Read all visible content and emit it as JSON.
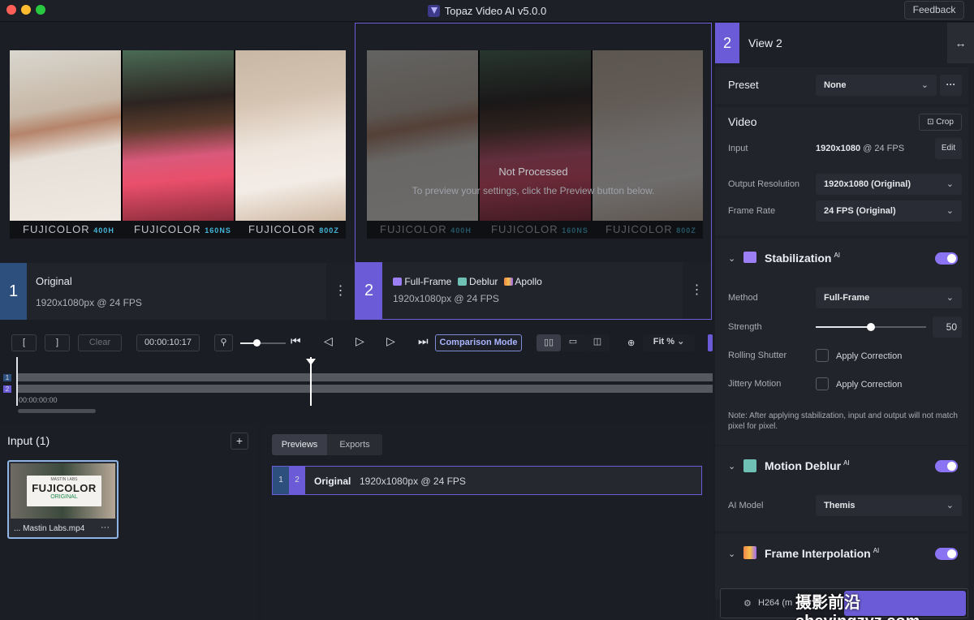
{
  "app": {
    "title": "Topaz Video AI  v5.0.0",
    "feedback": "Feedback"
  },
  "colors": {
    "accent": "#6b5bd6",
    "toggle": "#8b74f4",
    "bg": "#1b1d24"
  },
  "viewer": {
    "film_labels": [
      {
        "brand": "FUJICOLOR",
        "code": "400H"
      },
      {
        "brand": "FUJICOLOR",
        "code": "160NS"
      },
      {
        "brand": "FUJICOLOR",
        "code": "800Z"
      }
    ],
    "not_processed_title": "Not Processed",
    "not_processed_sub": "To preview your settings, click the Preview button below.",
    "view1": {
      "number": "1",
      "name": "Original",
      "meta": "1920x1080px @ 24 FPS",
      "more": "⋮"
    },
    "view2": {
      "number": "2",
      "models": [
        "Full-Frame",
        "Deblur",
        "Apollo"
      ],
      "meta": "1920x1080px @ 24 FPS",
      "more": "⋮"
    }
  },
  "transport": {
    "mark_in": "[",
    "mark_out": "]",
    "clear": "Clear",
    "timecode": "00:00:10:17",
    "comparison_mode": "Comparison Mode",
    "zoom": "Fit %",
    "zoom_slider_level": 0.35
  },
  "timeline": {
    "start_time": "00:00:00:00",
    "track1": "1",
    "track2": "2",
    "playhead_fraction": 0.42
  },
  "input_panel": {
    "title": "Input (1)",
    "add": "+",
    "thumb_text_top": "MASTIN LABS",
    "thumb_brand": "FUJICOLOR",
    "thumb_text_bottom": "ORIGINAL",
    "file_name": "... Mastin Labs.mp4",
    "file_more": "···"
  },
  "previews_panel": {
    "tabs": [
      "Previews",
      "Exports"
    ],
    "row": {
      "n1": "1",
      "n2": "2",
      "name": "Original",
      "meta": "1920x1080px @ 24 FPS"
    }
  },
  "sidebar": {
    "view_number": "2",
    "view_title": "View 2",
    "preset_label": "Preset",
    "preset_value": "None",
    "video_title": "Video",
    "crop": "Crop",
    "input_label": "Input",
    "input_res": "1920x1080",
    "input_fps": "@ 24 FPS",
    "edit": "Edit",
    "output_res_label": "Output Resolution",
    "output_res_value": "1920x1080 (Original)",
    "frame_rate_label": "Frame Rate",
    "frame_rate_value": "24 FPS (Original)",
    "stabilization": {
      "title": "Stabilization",
      "ai": "AI",
      "method_label": "Method",
      "method_value": "Full-Frame",
      "strength_label": "Strength",
      "strength_value": "50",
      "rolling_label": "Rolling Shutter",
      "jittery_label": "Jittery Motion",
      "apply": "Apply Correction",
      "note": "Note: After applying stabilization, input and output will not match pixel for pixel."
    },
    "motion_deblur": {
      "title": "Motion Deblur",
      "ai": "AI",
      "model_label": "AI Model",
      "model_value": "Themis"
    },
    "frame_interp": {
      "title": "Frame Interpolation",
      "ai": "AI"
    },
    "export_codec": "H264 (m"
  },
  "watermark": "摄影前沿 sheyingzyz.com"
}
